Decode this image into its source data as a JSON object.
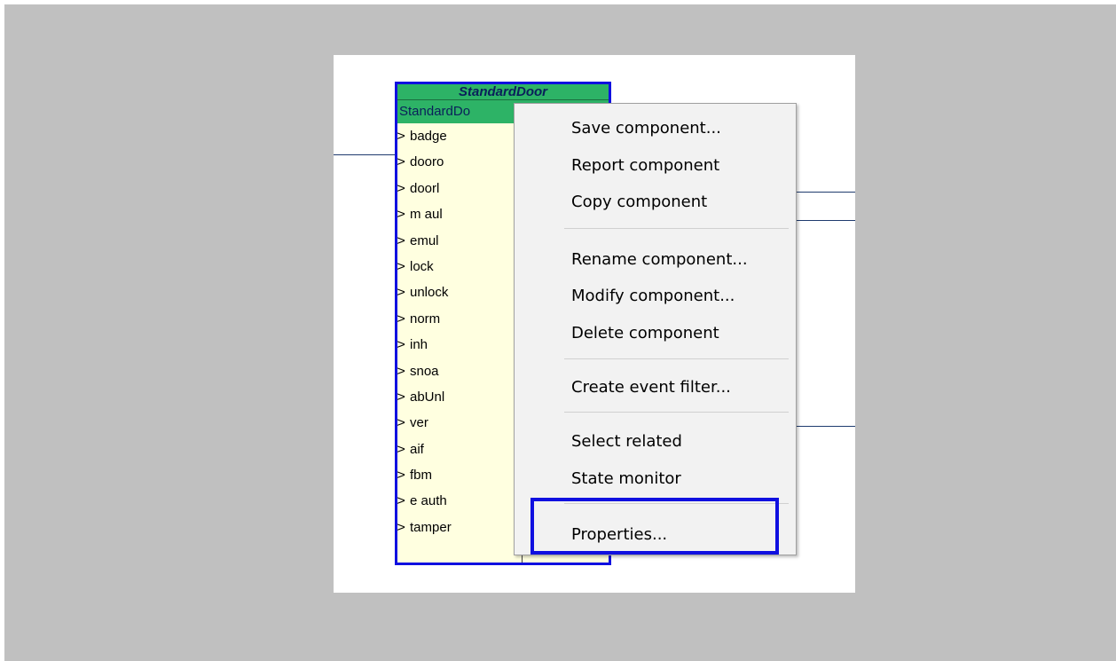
{
  "component": {
    "title": "StandardDoor",
    "type_label": "StandardDo",
    "ports": [
      "badge",
      "dooro",
      "doorl",
      "m aul",
      "emul",
      "lock",
      "unlock",
      "norm",
      "inh",
      "snoa",
      "abUnl",
      "ver",
      "aif",
      "fbm",
      "e auth",
      "tamper"
    ]
  },
  "context_menu": {
    "items": [
      {
        "label": "Save component..."
      },
      {
        "label": "Report component"
      },
      {
        "label": "Copy component"
      },
      {
        "label": "Rename component..."
      },
      {
        "label": "Modify component..."
      },
      {
        "label": "Delete component"
      },
      {
        "label": "Create event filter..."
      },
      {
        "label": "Select related"
      },
      {
        "label": "State monitor"
      },
      {
        "label": "Properties..."
      }
    ]
  },
  "colors": {
    "canvas_bg": "#c0c0c0",
    "component_border": "#1010e0",
    "component_header": "#2db366",
    "component_body": "#ffffe0",
    "highlight": "#1010e0",
    "wire": "#1f3b6e"
  }
}
